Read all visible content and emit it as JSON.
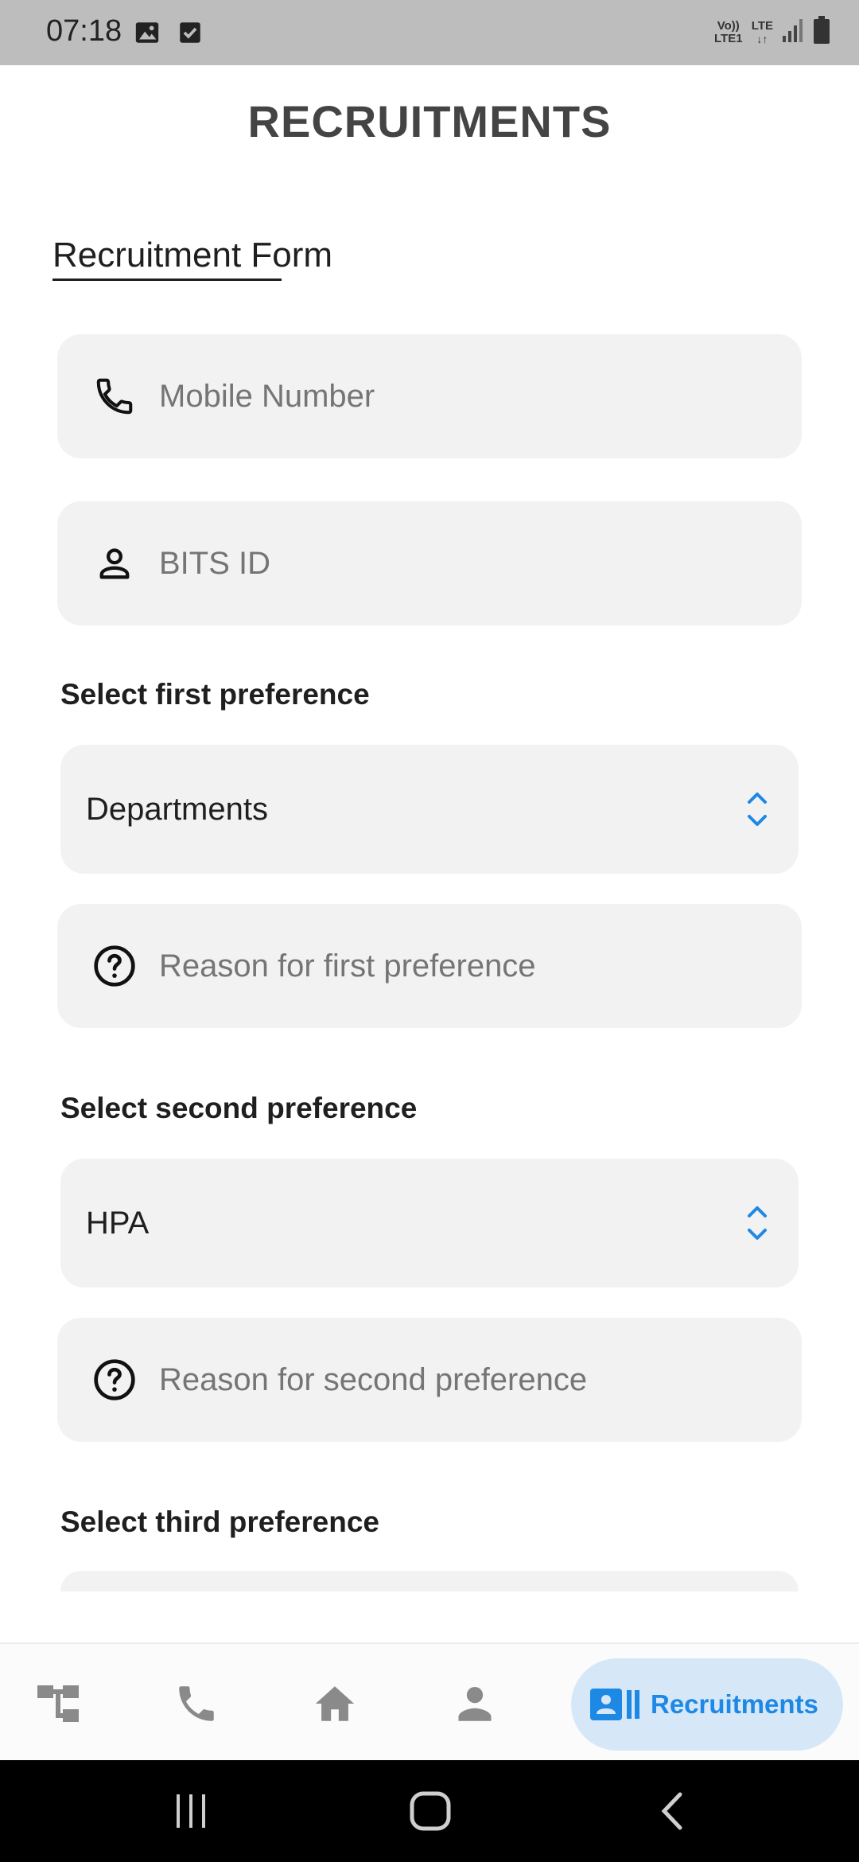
{
  "status_bar": {
    "time": "07:18",
    "left_icons": [
      "image-icon",
      "checkbox-icon"
    ],
    "network_label_1": "Vo)) LTE1",
    "network_label_2": "LTE",
    "right_icons": [
      "signal-icon",
      "battery-icon"
    ]
  },
  "page": {
    "title": "RECRUITMENTS"
  },
  "form": {
    "heading": "Recruitment Form",
    "mobile": {
      "placeholder": "Mobile Number",
      "value": "",
      "icon": "phone-icon"
    },
    "bits_id": {
      "placeholder": "BITS ID",
      "value": "",
      "icon": "person-icon"
    },
    "first_preference": {
      "label": "Select first preference",
      "selected": "Departments",
      "reason_placeholder": "Reason for first preference"
    },
    "second_preference": {
      "label": "Select second preference",
      "selected": "HPA",
      "reason_placeholder": "Reason for second preference"
    },
    "third_preference": {
      "label": "Select third preference"
    }
  },
  "bottom_nav": {
    "items": [
      {
        "icon": "hierarchy-icon"
      },
      {
        "icon": "phone-icon"
      },
      {
        "icon": "home-icon"
      },
      {
        "icon": "person-icon"
      }
    ],
    "active": {
      "icon": "contact-card-icon",
      "label": "Recruitments"
    }
  },
  "system_nav": {
    "buttons": [
      "recents-icon",
      "home-icon",
      "back-icon"
    ]
  },
  "colors": {
    "accent": "#1e88e5",
    "active_pill": "#d6e8f8",
    "field_bg": "#f2f2f2",
    "status_bar": "#bdbdbd"
  }
}
